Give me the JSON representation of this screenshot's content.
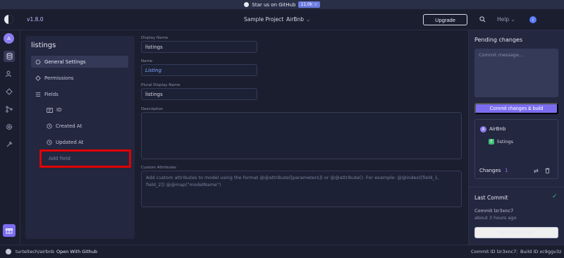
{
  "banner": {
    "text": "Star us on GitHub",
    "stars": "11.0k ☆"
  },
  "header": {
    "version": "v1.8.0",
    "project": "Sample Project",
    "app": "AirBnb",
    "upgrade_label": "Upgrade",
    "help_label": "Help",
    "info_badge": "i"
  },
  "rail": {
    "avatar_letter": "A"
  },
  "left_panel": {
    "title": "listings",
    "items": [
      {
        "label": "General Settings"
      },
      {
        "label": "Permissions"
      },
      {
        "label": "Fields"
      }
    ],
    "fields": [
      {
        "label": "ID"
      },
      {
        "label": "Created At"
      },
      {
        "label": "Updated At"
      }
    ],
    "add_field_label": "Add field"
  },
  "form": {
    "display_name_label": "Display Name",
    "display_name_value": "listings",
    "name_label": "Name",
    "name_value": "Listing",
    "plural_label": "Plural Display Name",
    "plural_value": "listings",
    "description_label": "Description",
    "custom_attributes_label": "Custom Attributes",
    "custom_attributes_placeholder": "Add custom attributes to model using the format @@attribute([parameters]) or @@attribute(). For example: @@index([field_1, field_2]) @@map(\"modelName\")"
  },
  "pending": {
    "title": "Pending changes",
    "commit_placeholder": "Commit message...",
    "commit_button": "Commit changes & build",
    "resource_avatar": "A",
    "resource_name": "AirBnb",
    "entity_badge": "E",
    "entity_name": "listings",
    "changes_label": "Changes",
    "changes_count": "1",
    "last_commit_title": "Last Commit",
    "commit_id_line": "Commit lzr3xnc7",
    "commit_time": "about 3 hours ago",
    "go_to_code": "Go to view code"
  },
  "footer": {
    "repo": "turteltech/airbnb",
    "open_github": "Open With Github",
    "commit_id": "Commit ID lzr3xnc7",
    "separator": "|",
    "build_id": "Build ID xc9ggv3z"
  },
  "colors": {
    "accent": "#7b6cf0",
    "highlight_box": "#e00000",
    "success": "#3fbf76"
  }
}
